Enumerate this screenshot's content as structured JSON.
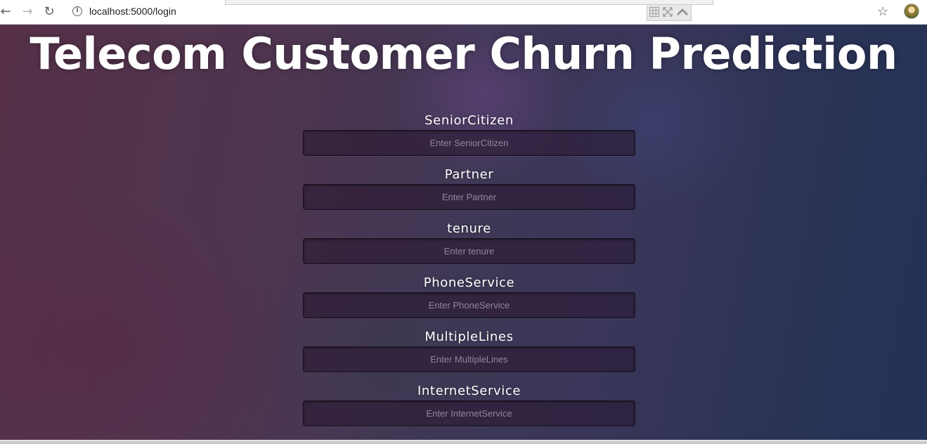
{
  "browser": {
    "url": "localhost:5000/login",
    "back_icon": "←",
    "forward_icon": "→",
    "reload_icon": "↻",
    "info_icon": "i",
    "star_icon": "☆"
  },
  "page": {
    "title": "Telecom Customer Churn Prediction"
  },
  "form": {
    "fields": [
      {
        "label": "SeniorCitizen",
        "placeholder": "Enter SeniorCitizen",
        "value": ""
      },
      {
        "label": "Partner",
        "placeholder": "Enter Partner",
        "value": ""
      },
      {
        "label": "tenure",
        "placeholder": "Enter tenure",
        "value": ""
      },
      {
        "label": "PhoneService",
        "placeholder": "Enter PhoneService",
        "value": ""
      },
      {
        "label": "MultipleLines",
        "placeholder": "Enter MultipleLines",
        "value": ""
      },
      {
        "label": "InternetService",
        "placeholder": "Enter InternetService",
        "value": ""
      }
    ]
  },
  "colors": {
    "page_background_left": "#563148",
    "page_background_right": "#233257",
    "title_text": "#ffffff",
    "input_background": "#2d1a33",
    "placeholder_text": "#8e8798"
  }
}
